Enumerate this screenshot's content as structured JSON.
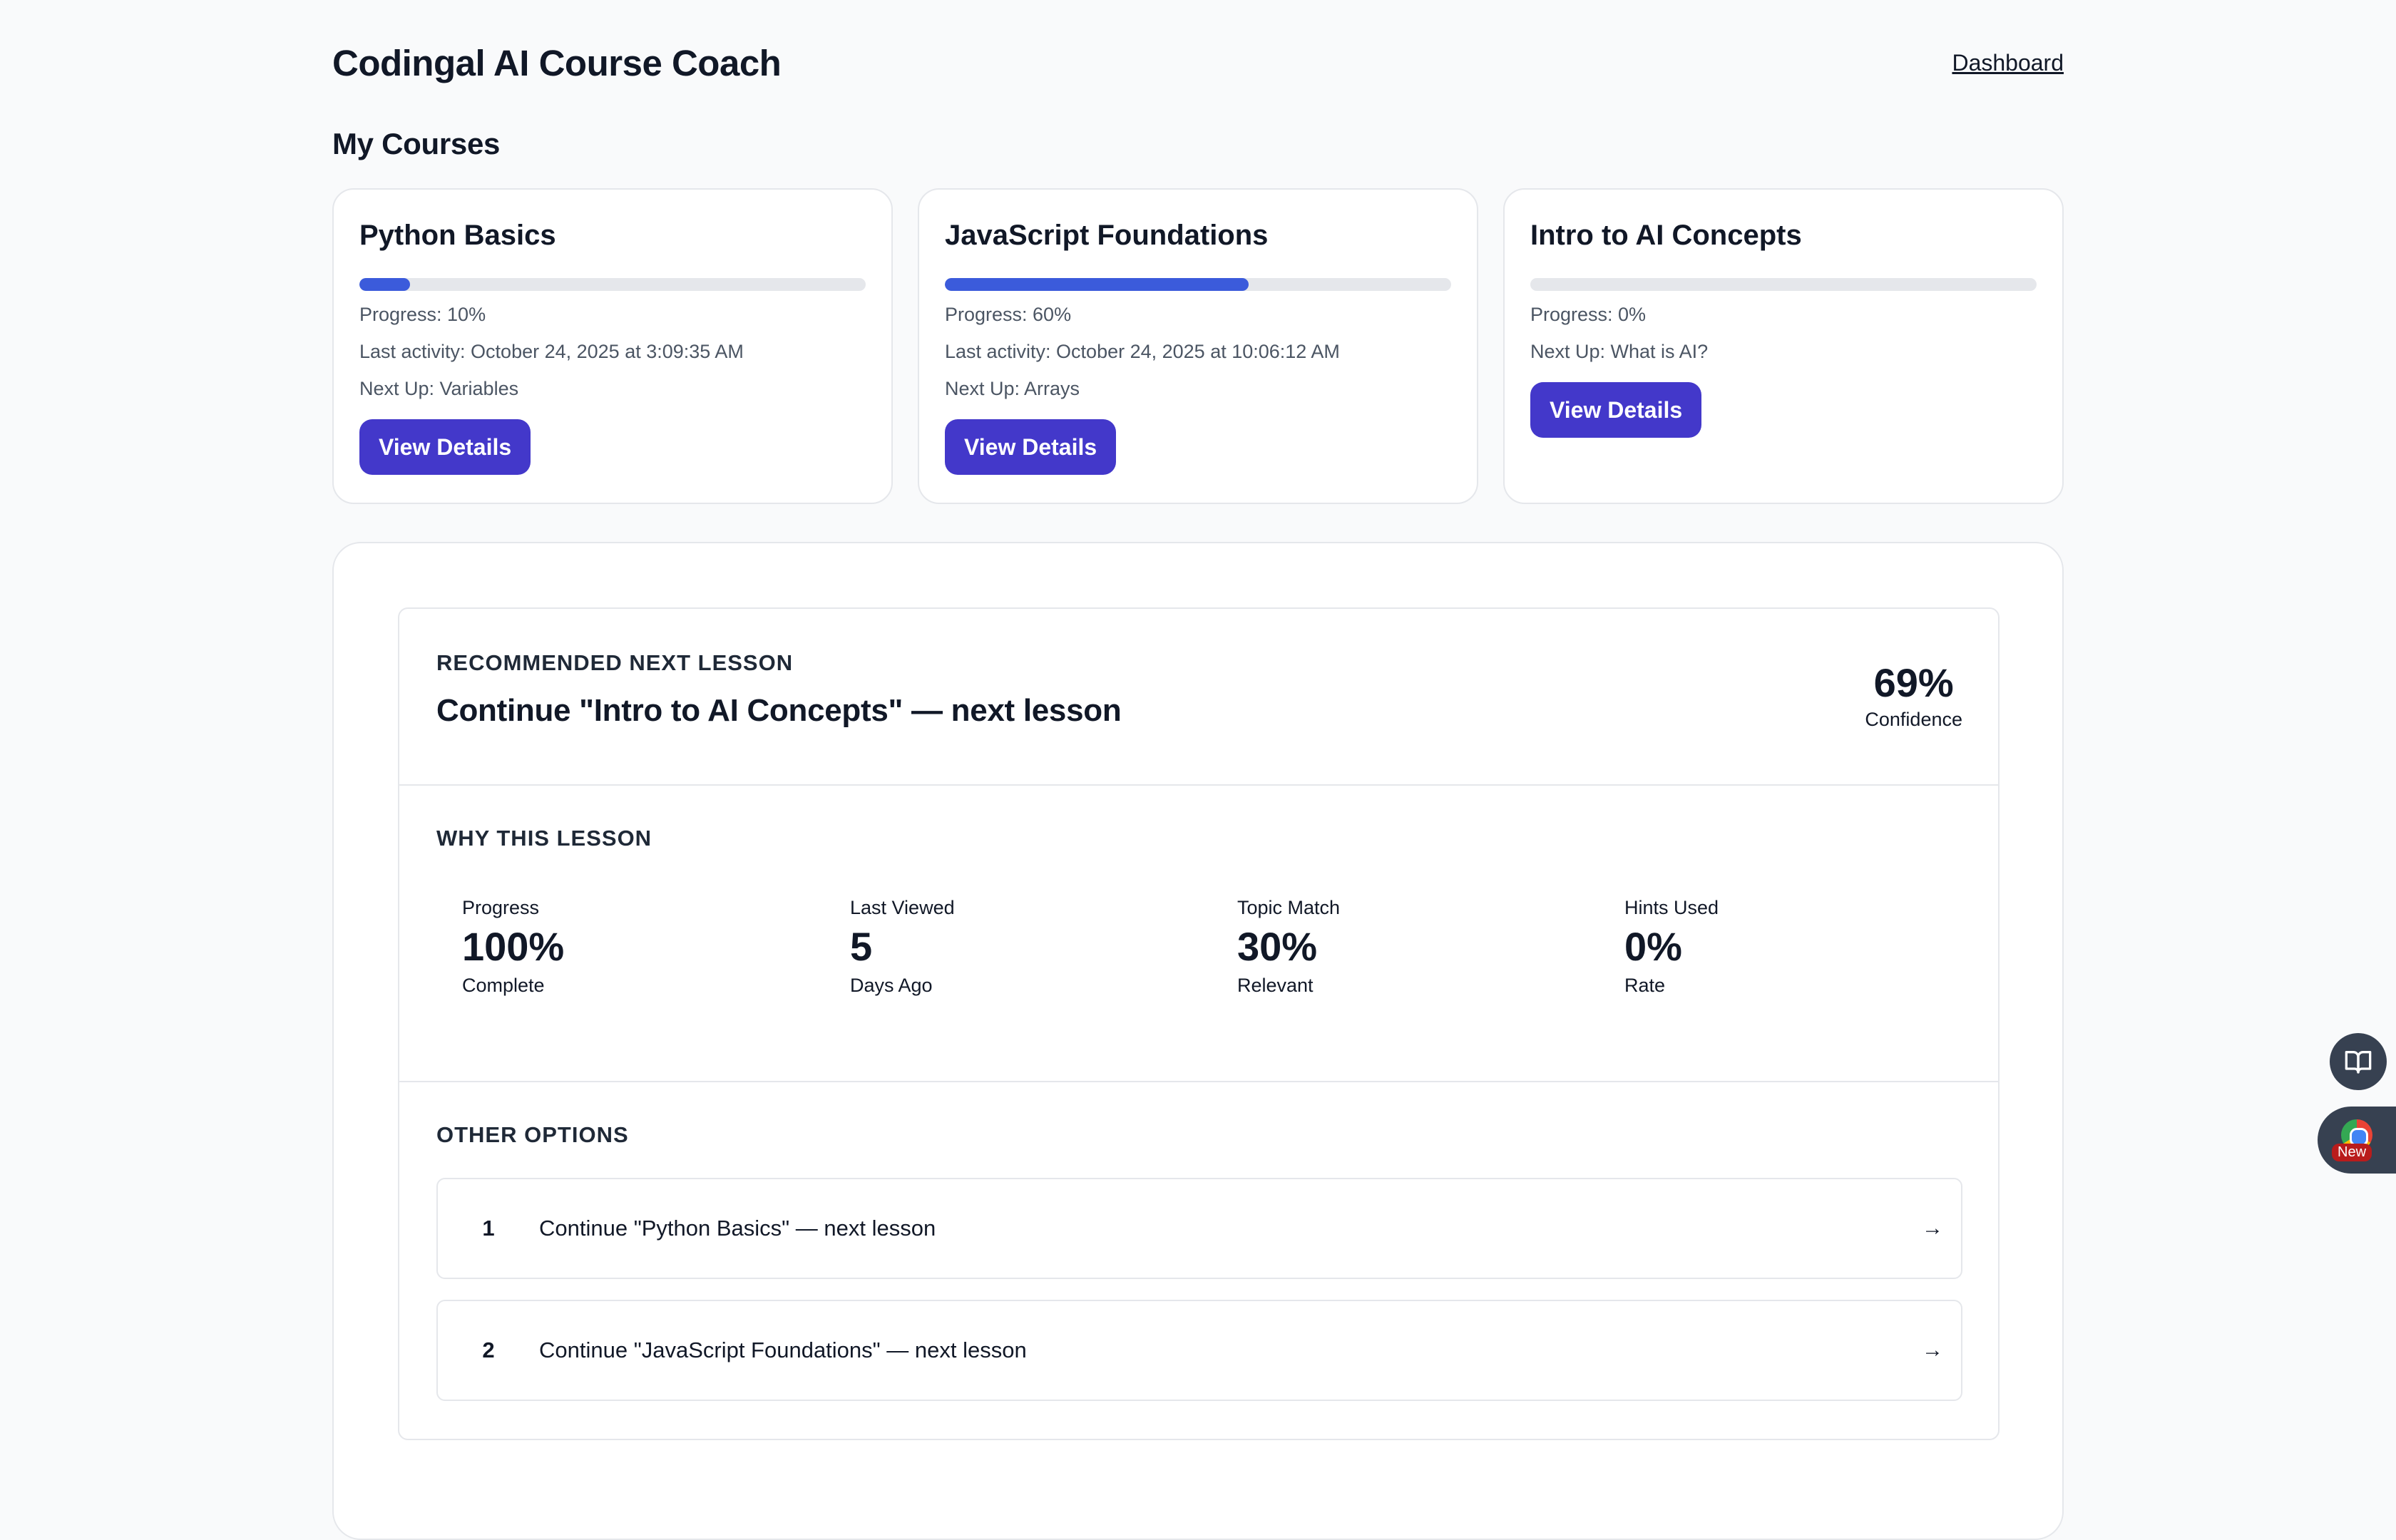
{
  "header": {
    "title": "Codingal AI Course Coach",
    "nav_link": "Dashboard"
  },
  "courses_section": {
    "title": "My Courses"
  },
  "courses": [
    {
      "name": "Python Basics",
      "progress": 10,
      "progress_text": "Progress: 10%",
      "last_activity": "Last activity: October 24, 2025 at 3:09:35 AM",
      "next_up": "Next Up: Variables",
      "button_label": "View Details"
    },
    {
      "name": "JavaScript Foundations",
      "progress": 60,
      "progress_text": "Progress: 60%",
      "last_activity": "Last activity: October 24, 2025 at 10:06:12 AM",
      "next_up": "Next Up: Arrays",
      "button_label": "View Details"
    },
    {
      "name": "Intro to AI Concepts",
      "progress": 0,
      "progress_text": "Progress: 0%",
      "next_up": "Next Up: What is AI?",
      "button_label": "View Details"
    }
  ],
  "recommendation": {
    "label": "RECOMMENDED NEXT LESSON",
    "title": "Continue \"Intro to AI Concepts\" — next lesson",
    "confidence_value": "69%",
    "confidence_label": "Confidence"
  },
  "why": {
    "label": "WHY THIS LESSON",
    "stats": [
      {
        "title": "Progress",
        "value": "100%",
        "sub": "Complete"
      },
      {
        "title": "Last Viewed",
        "value": "5",
        "sub": "Days Ago"
      },
      {
        "title": "Topic Match",
        "value": "30%",
        "sub": "Relevant"
      },
      {
        "title": "Hints Used",
        "value": "0%",
        "sub": "Rate"
      }
    ]
  },
  "other": {
    "label": "OTHER OPTIONS",
    "options": [
      {
        "num": "1",
        "text": "Continue \"Python Basics\" — next lesson",
        "arrow": "→"
      },
      {
        "num": "2",
        "text": "Continue \"JavaScript Foundations\" — next lesson",
        "arrow": "→"
      }
    ]
  },
  "floating": {
    "book_icon": "book-open-icon",
    "extension_badge": "New"
  },
  "colors": {
    "accent": "#4338ca",
    "progress_fill": "#3b5bdb",
    "track": "#e5e7eb",
    "page_bg": "#f9fafb"
  }
}
